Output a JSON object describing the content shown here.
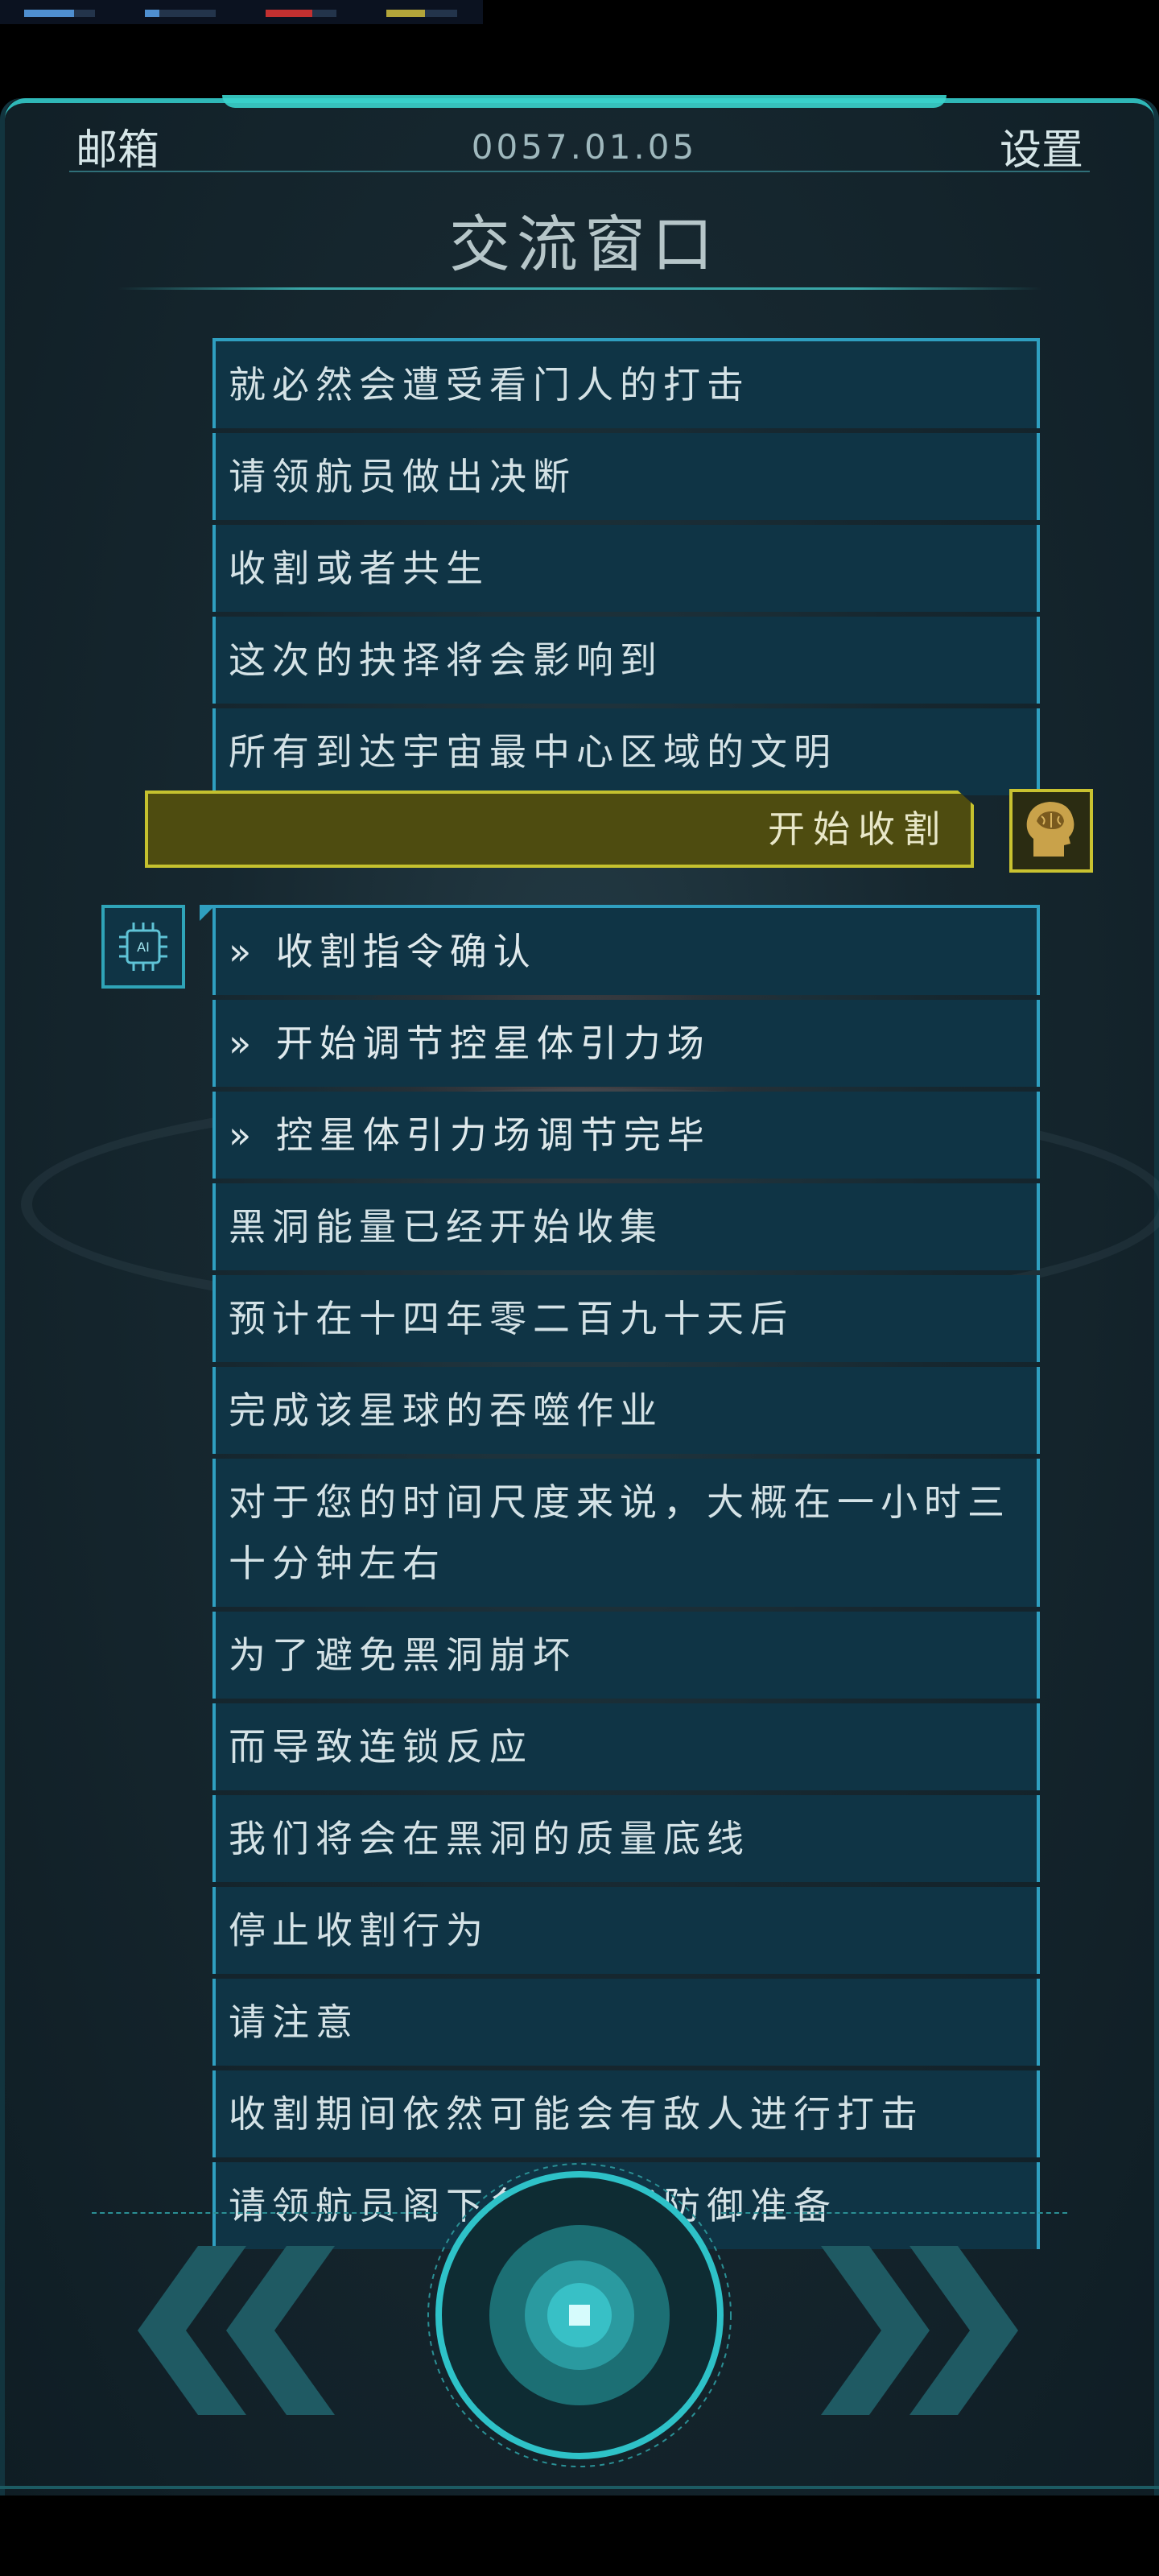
{
  "header": {
    "mailbox_label": "邮箱",
    "date": "0057.01.05",
    "settings_label": "设置"
  },
  "title": "交流窗口",
  "messages_top": [
    "就必然会遭受看门人的打击",
    "请领航员做出决断",
    "收割或者共生",
    "这次的抉择将会影响到",
    "所有到达宇宙最中心区域的文明"
  ],
  "user_choice": "开始收割",
  "ai_label": "AI",
  "messages_ai": [
    "» 收割指令确认",
    "» 开始调节控星体引力场",
    "» 控星体引力场调节完毕",
    "黑洞能量已经开始收集",
    "预计在十四年零二百九十天后",
    "完成该星球的吞噬作业",
    "对于您的时间尺度来说，大概在一小时三十分钟左右",
    "为了避免黑洞崩坏",
    "而导致连锁反应",
    "我们将会在黑洞的质量底线",
    "停止收割行为",
    "请注意",
    "收割期间依然可能会有敌人进行打击",
    "请领航员阁下务必做好防御准备"
  ],
  "icons": {
    "back": "double-chevron-left-icon",
    "forward": "double-chevron-right-icon",
    "user": "brain-head-icon",
    "ai": "chip-icon"
  },
  "colors": {
    "accent": "#2fb8b8",
    "message_bg": "#0f3445",
    "user_bubble": "#4e4c10",
    "user_border": "#c5c12e"
  }
}
